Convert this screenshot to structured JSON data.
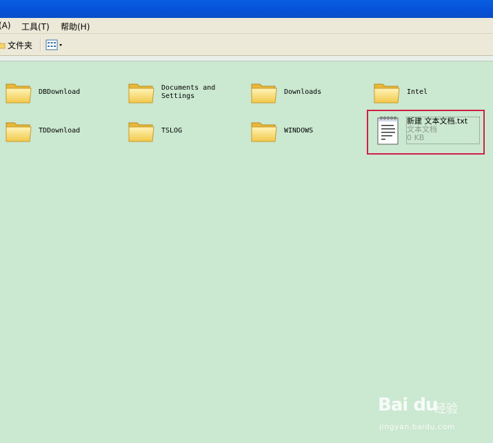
{
  "menu": {
    "items": [
      "(A)",
      "工具(T)",
      "帮助(H)"
    ]
  },
  "toolbar": {
    "folders_label": "文件夹",
    "views_icon": "views-grid-icon"
  },
  "folders": [
    {
      "name": "DBDownload"
    },
    {
      "name": "Documents and\nSettings"
    },
    {
      "name": "Downloads"
    },
    {
      "name": "Intel"
    },
    {
      "name": "TDDownload"
    },
    {
      "name": "TSLOG"
    },
    {
      "name": "WINDOWS"
    }
  ],
  "file": {
    "name": "新建 文本文档.txt",
    "type": "文本文档",
    "size": "0 KB",
    "icon": "notepad-text-file-icon"
  },
  "watermark": {
    "brand": "Bai du",
    "cn": "经验",
    "url": "jingyan.baidu.com"
  },
  "colors": {
    "background": "#cbe8d0",
    "highlight": "#d21d47",
    "titlebar": "#0550d8"
  }
}
